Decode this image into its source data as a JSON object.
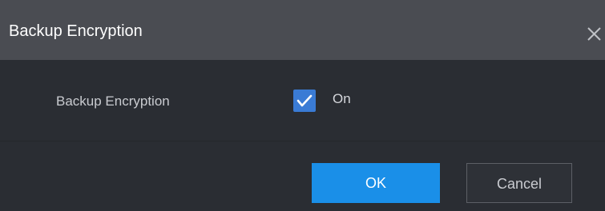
{
  "dialog": {
    "title": "Backup Encryption",
    "close_icon": "close-icon"
  },
  "form": {
    "encryption_label": "Backup Encryption",
    "encryption_enabled": true,
    "encryption_option_label": "On",
    "checkbox_icon": "checkmark-icon"
  },
  "buttons": {
    "ok_label": "OK",
    "cancel_label": "Cancel"
  },
  "colors": {
    "titlebar": "#4a4c52",
    "body": "#2a2d33",
    "checkbox": "#3a7bd5",
    "primary_button": "#1a8fe8"
  }
}
